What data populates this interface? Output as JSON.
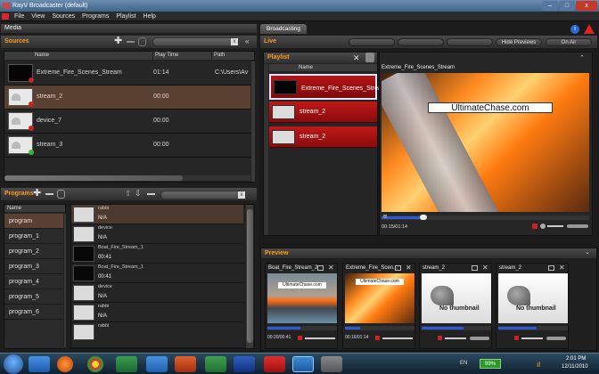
{
  "window": {
    "title": "RayV Broadcaster (default)",
    "min": "–",
    "max": "□",
    "close": "x"
  },
  "menu": [
    "File",
    "View",
    "Sources",
    "Programs",
    "Playlist",
    "Help"
  ],
  "media": {
    "title": "Media",
    "sources_title": "Sources",
    "columns": {
      "name": "Name",
      "play_time": "Play Time",
      "path": "Path"
    },
    "rows": [
      {
        "name": "Extreme_Fire_Scenes_Stream",
        "time": "01:14",
        "path": "C:\\Users\\Av",
        "thumb": "black",
        "status": "error"
      },
      {
        "name": "stream_2",
        "time": "00:00",
        "path": "",
        "thumb": "nothumb",
        "status": "error"
      },
      {
        "name": "device_7",
        "time": "00:00",
        "path": "",
        "thumb": "nothumb",
        "status": "error"
      },
      {
        "name": "stream_3",
        "time": "00:00",
        "path": "",
        "thumb": "nothumb",
        "status": "ok"
      }
    ]
  },
  "programs": {
    "title": "Programs",
    "name_col": "Name",
    "items": [
      "program",
      "program_1",
      "program_2",
      "program_3",
      "program_4",
      "program_5",
      "program_6"
    ],
    "segments": [
      {
        "label": "rabbi",
        "time": "N/A"
      },
      {
        "label": "device",
        "time": "N/A"
      },
      {
        "label": "Boat_Fire_Stream_1",
        "time": "00:41"
      },
      {
        "label": "Boat_Fire_Stream_1",
        "time": "00:41"
      },
      {
        "label": "device",
        "time": "N/A"
      },
      {
        "label": "rabbi",
        "time": "N/A"
      },
      {
        "label": "rabbi",
        "time": ""
      }
    ]
  },
  "broadcasting": {
    "tab": "Broadcasting",
    "live_title": "Live",
    "hide_previews": "Hide Previews",
    "on_air": "On Air",
    "playlist_title": "Playlist",
    "playlist_name_col": "Name",
    "playlist": [
      "Extreme_Fire_Scenes_Stream",
      "stream_2",
      "stream_2"
    ],
    "player_title": "Extreme_Fire_Scenes_Stream",
    "player_overlay": "UltimateChase.com",
    "player_time": "00:15/01:14",
    "player_progress": 0.2
  },
  "preview": {
    "title": "Preview",
    "cards": [
      {
        "title": "Boat_Fire_Stream_2",
        "kind": "boat",
        "time": "00:20/00:41",
        "overlay": "UltimateChase.com"
      },
      {
        "title": "Extreme_Fire_Scen...",
        "kind": "fire",
        "time": "00:16/01:14",
        "overlay": "UltimateChase.com"
      },
      {
        "title": "stream_2",
        "kind": "nothumb",
        "time": "",
        "overlay": "No thumbnail"
      },
      {
        "title": "stream_2",
        "kind": "nothumb",
        "time": "",
        "overlay": "No thumbnail"
      }
    ]
  },
  "taskbar": {
    "lang": "EN",
    "battery": "99%",
    "time": "2:01 PM",
    "date": "12/11/2010"
  },
  "colors": {
    "accent": "#ff9a1a",
    "selected_row": "#5a4030",
    "playlist_red": "#c01818"
  }
}
